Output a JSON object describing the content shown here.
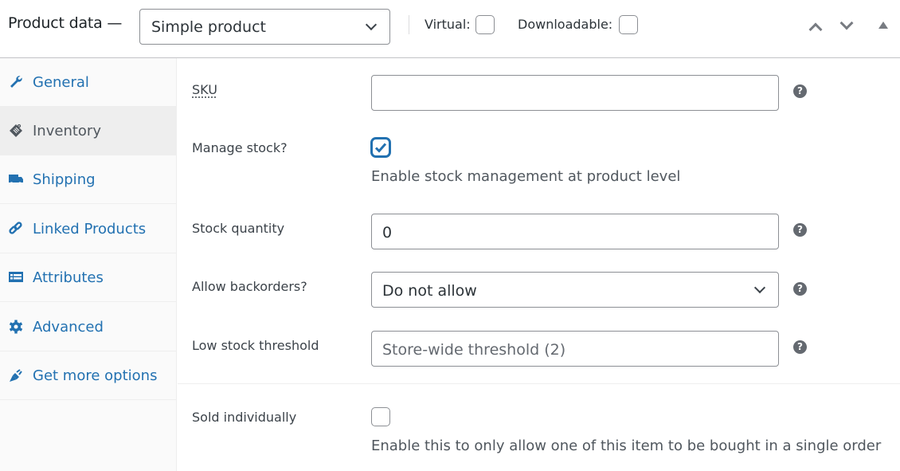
{
  "header": {
    "title": "Product data —",
    "product_type": "Simple product",
    "virtual_label": "Virtual:",
    "virtual_checked": false,
    "downloadable_label": "Downloadable:",
    "downloadable_checked": false,
    "icons": {
      "move_up": "chevron-up-icon",
      "move_down": "chevron-down-icon",
      "toggle": "triangle-up-icon"
    }
  },
  "sidebar": {
    "items": [
      {
        "label": "General",
        "icon": "wrench-icon",
        "active": false
      },
      {
        "label": "Inventory",
        "icon": "clipboard-tag-icon",
        "active": true
      },
      {
        "label": "Shipping",
        "icon": "truck-icon",
        "active": false
      },
      {
        "label": "Linked Products",
        "icon": "link-icon",
        "active": false
      },
      {
        "label": "Attributes",
        "icon": "list-table-icon",
        "active": false
      },
      {
        "label": "Advanced",
        "icon": "gear-icon",
        "active": false
      },
      {
        "label": "Get more options",
        "icon": "plug-icon",
        "active": false
      }
    ]
  },
  "inventory": {
    "sku": {
      "label": "SKU",
      "value": ""
    },
    "manage_stock": {
      "label": "Manage stock?",
      "checked": true,
      "description": "Enable stock management at product level"
    },
    "stock_quantity": {
      "label": "Stock quantity",
      "value": "0"
    },
    "backorders": {
      "label": "Allow backorders?",
      "selected": "Do not allow"
    },
    "low_stock": {
      "label": "Low stock threshold",
      "placeholder": "Store-wide threshold (2)"
    },
    "sold_individually": {
      "label": "Sold individually",
      "checked": false,
      "description": "Enable this to only allow one of this item to be bought in a single order"
    },
    "help_glyph": "?"
  },
  "colors": {
    "accent": "#2271b1",
    "active_tab_bg": "#eeeeee",
    "sidebar_bg": "#fafafa",
    "help_icon": "#646970"
  }
}
